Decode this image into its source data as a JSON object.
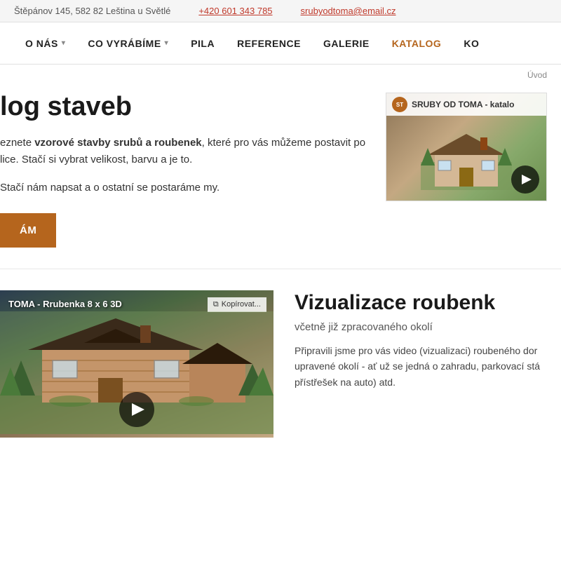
{
  "topbar": {
    "address": "Štěpánov 145, 582 82 Leština u Světlé",
    "phone": "+420 601 343 785",
    "email": "srubyodtoma@email.cz"
  },
  "nav": {
    "items": [
      {
        "label": "O NÁS",
        "hasChevron": true,
        "active": false
      },
      {
        "label": "CO VYRÁBÍME",
        "hasChevron": true,
        "active": false
      },
      {
        "label": "PILA",
        "hasChevron": false,
        "active": false
      },
      {
        "label": "REFERENCE",
        "hasChevron": false,
        "active": false
      },
      {
        "label": "GALERIE",
        "hasChevron": false,
        "active": false
      },
      {
        "label": "KATALOG",
        "hasChevron": false,
        "active": true
      },
      {
        "label": "KO",
        "hasChevron": false,
        "active": false
      }
    ]
  },
  "breadcrumb": {
    "text": "Úvod"
  },
  "hero": {
    "title": "log staveb",
    "description_prefix": "eznete ",
    "description_bold": "vzorové stavby srubů a roubenek",
    "description_suffix": ", které pro vás můžeme postavit po lice. Stačí si vybrat velikost, barvu a je to.",
    "cta_text": "Stačí nám napsat a o ostatní se postaráme my.",
    "button_label": "ÁM"
  },
  "video_thumb": {
    "title": "SRUBY OD TOMA - katalo",
    "logo_text": "ST"
  },
  "bottom_video": {
    "title": "TOMA - Rrubenka 8 x 6 3D",
    "copy_label": "Kopírovat..."
  },
  "bottom_section": {
    "title": "Vizualizace roubenk",
    "subtitle": "včetně již zpracovaného okolí",
    "body": "Připravili jsme pro vás video (vizualizaci) roubeného dor upravené okolí - ať už se jedná o zahradu, parkovací stá přístřešek na auto) atd."
  }
}
